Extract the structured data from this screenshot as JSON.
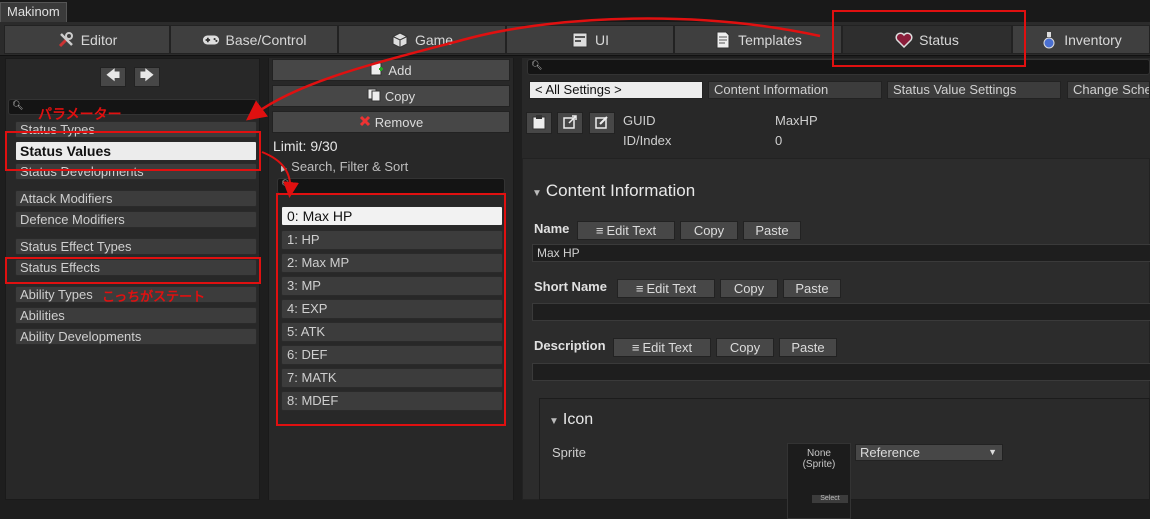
{
  "window": {
    "title": "Makinom"
  },
  "toolbar": {
    "tabs": [
      {
        "label": "Editor",
        "icon": "tools-icon"
      },
      {
        "label": "Base/Control",
        "icon": "gamepad-icon"
      },
      {
        "label": "Game",
        "icon": "cube-icon"
      },
      {
        "label": "UI",
        "icon": "ui-icon"
      },
      {
        "label": "Templates",
        "icon": "document-icon"
      },
      {
        "label": "Status",
        "icon": "heart-icon",
        "active": true
      },
      {
        "label": "Inventory",
        "icon": "potion-icon"
      }
    ]
  },
  "left": {
    "nav_back": "🡄",
    "nav_forward": "🡆",
    "items": [
      {
        "label": "Status Types"
      },
      {
        "label": "Status Values",
        "selected": true
      },
      {
        "label": "Status Developments"
      },
      {
        "label": "Attack Modifiers"
      },
      {
        "label": "Defence Modifiers"
      },
      {
        "label": "Status Effect Types"
      },
      {
        "label": "Status Effects"
      },
      {
        "label": "Ability Types"
      },
      {
        "label": "Abilities"
      },
      {
        "label": "Ability Developments"
      }
    ]
  },
  "middle": {
    "add_label": "Add",
    "copy_label": "Copy",
    "remove_label": "Remove",
    "limit": "Limit: 9/30",
    "search_filter_sort": "Search, Filter & Sort",
    "items": [
      "0: Max HP",
      "1: HP",
      "2: Max MP",
      "3: MP",
      "4: EXP",
      "5: ATK",
      "6: DEF",
      "7: MATK",
      "8: MDEF"
    ],
    "selected_index": 0
  },
  "right": {
    "tabs": [
      "< All Settings >",
      "Content Information",
      "Status Value Settings",
      "Change Sche"
    ],
    "guid_label": "GUID",
    "guid_value": "MaxHP",
    "index_label": "ID/Index",
    "index_value": "0",
    "section_title": "Content Information",
    "name": {
      "label": "Name",
      "value": "Max HP"
    },
    "short_name": {
      "label": "Short Name",
      "value": ""
    },
    "description": {
      "label": "Description",
      "value": ""
    },
    "edit_text_label": "Edit Text",
    "copy_label": "Copy",
    "paste_label": "Paste",
    "icon_section": "Icon",
    "sprite_label": "Sprite",
    "sprite_none": "None",
    "sprite_type": "(Sprite)",
    "sprite_select": "Select",
    "sprite_mode": "Reference"
  },
  "annotations": {
    "parameter": "パラメーター",
    "status_effect": "こっちがステート"
  },
  "colors": {
    "accent_red": "#e01010",
    "selected_bg": "#ececec"
  }
}
